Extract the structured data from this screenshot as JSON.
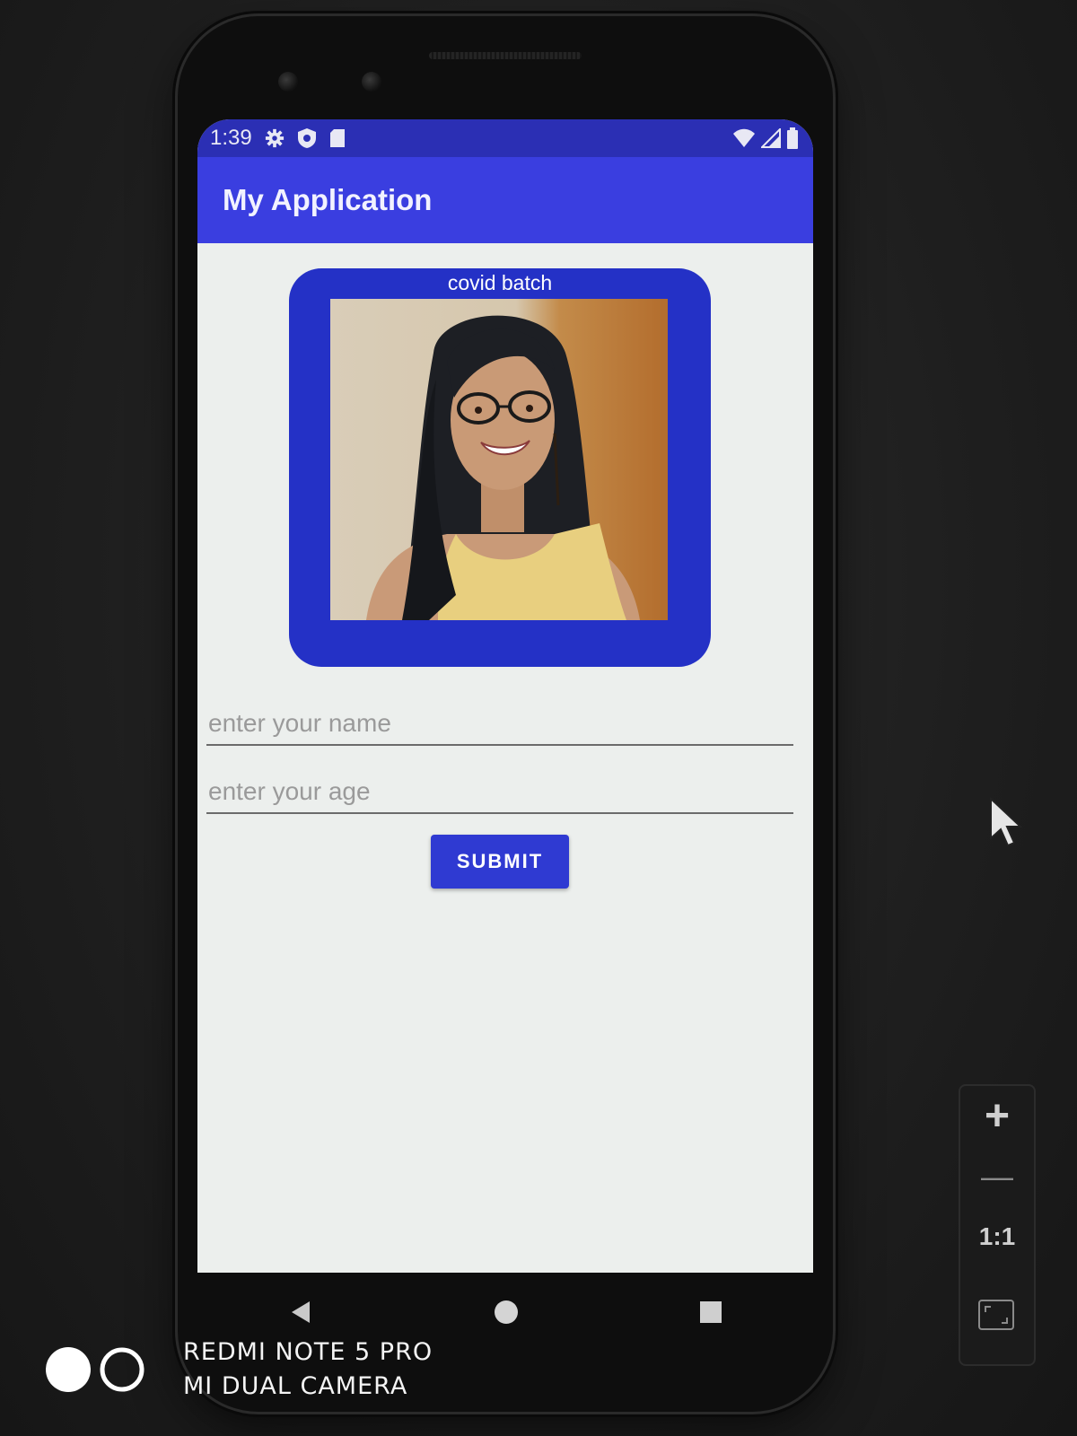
{
  "status_bar": {
    "time": "1:39",
    "icons_left": [
      "gear-icon",
      "shield-icon",
      "sd-card-icon"
    ],
    "icons_right": [
      "wifi-icon",
      "signal-icon",
      "battery-icon"
    ]
  },
  "app_bar": {
    "title": "My Application"
  },
  "card": {
    "label": "covid batch",
    "image": "person-photo"
  },
  "form": {
    "name_placeholder": "enter your name",
    "age_placeholder": "enter your age",
    "submit_label": "SUBMIT"
  },
  "nav_bar": {
    "buttons": [
      "back-icon",
      "home-icon",
      "recents-icon"
    ]
  },
  "zoom_controls": {
    "plus": "+",
    "minus": "—",
    "ratio": "1:1"
  },
  "watermark": {
    "line1": "REDMI NOTE 5 PRO",
    "line2": "MI DUAL CAMERA"
  },
  "colors": {
    "status_bar": "#2b2fb4",
    "app_bar": "#3a3ee0",
    "card": "#2431c6",
    "button": "#2f3ad2",
    "screen_bg": "#ecefed"
  }
}
